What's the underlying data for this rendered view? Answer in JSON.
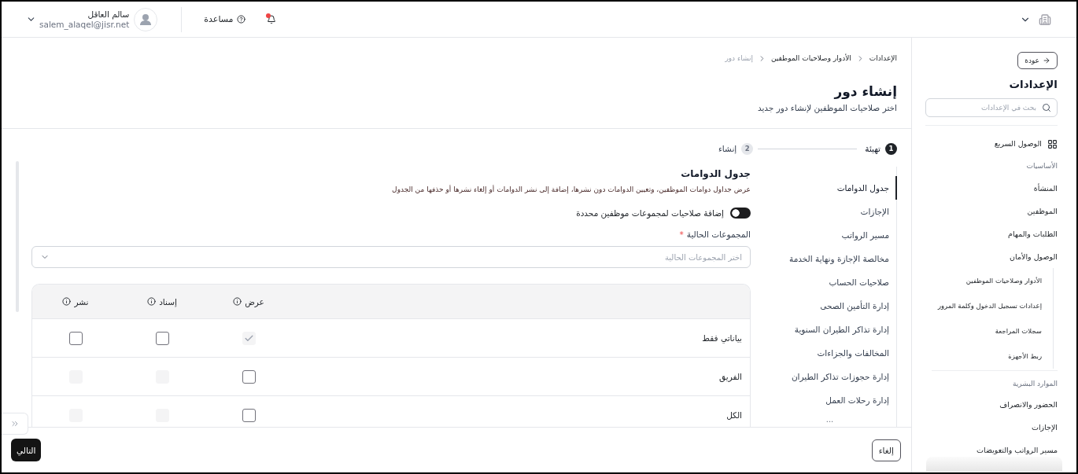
{
  "top_bar": {
    "notifications": {
      "unread": true
    },
    "help": {
      "label": "مساعدة"
    },
    "user": {
      "name": "سالم العاقل",
      "email": "salem_alaqel@jisr.net"
    }
  },
  "sidebar": {
    "back_button": {
      "label": "عودة"
    },
    "title": "الإعدادات",
    "search": {
      "placeholder": "بحث في الإعدادات"
    },
    "quick_access": {
      "label": "الوصول السريع"
    },
    "sections": [
      {
        "heading": "الأساسيات",
        "items": [
          {
            "label": "المنشأة"
          },
          {
            "label": "الموظفين"
          },
          {
            "label": "الطلبات والمهام"
          },
          {
            "label": "الوصول والأمان",
            "children": [
              {
                "label": "الأدوار وصلاحيات الموظفين"
              },
              {
                "label": "إعدادات تسجيل الدخول وكلمة المرور"
              },
              {
                "label": "سجلات المراجعة"
              },
              {
                "label": "ربط الأجهزة"
              }
            ]
          }
        ]
      },
      {
        "heading": "الموارد البشرية",
        "items": [
          {
            "label": "الحضور والانصراف"
          },
          {
            "label": "الإجازات"
          },
          {
            "label": "مسير الرواتب والتعويضات"
          }
        ]
      }
    ]
  },
  "breadcrumb": [
    {
      "label": "الإعدادات",
      "current": false
    },
    {
      "label": "الأدوار وصلاحيات الموظفين",
      "current": false
    },
    {
      "label": "إنشاء دور",
      "current": true
    }
  ],
  "page": {
    "title": "إنشاء دور",
    "subtitle": "اختر صلاحيات الموظفين لإنشاء دور جديد"
  },
  "stepper": [
    {
      "number": "1",
      "label": "تهيئة",
      "selected": true
    },
    {
      "number": "2",
      "label": "إنشاء",
      "selected": false
    }
  ],
  "section_nav": {
    "items": [
      {
        "label": "جدول الدوامات",
        "selected": true
      },
      {
        "label": "الإجازات",
        "selected": false
      },
      {
        "label": "مسير الرواتب",
        "selected": false
      },
      {
        "label": "مخالصة الإجازة ونهاية الخدمة",
        "selected": false
      },
      {
        "label": "صلاحيات الحساب",
        "selected": false
      },
      {
        "label": "إدارة التأمين الصحى",
        "selected": false
      },
      {
        "label": "إدارة تذاكر الطيران السنوية",
        "selected": false
      },
      {
        "label": "المخالفات والجزاءات",
        "selected": false
      },
      {
        "label": "إدارة حجوزات تذاكر الطيران",
        "selected": false
      },
      {
        "label": "إدارة رحلات العمل",
        "selected": false
      }
    ],
    "more": "..."
  },
  "section": {
    "title": "جدول الدوامات",
    "description": "عرض جداول دوامات الموظفين، وتعيين الدوامات دون نشرها، إضافة إلى نشر الدوامات أو إلغاء نشرها أو حذفها من الجدول",
    "toggle": {
      "label": "إضافة صلاحيات لمجموعات موظفين محددة",
      "on": true
    },
    "groups_field": {
      "label": "المجموعات الحالية",
      "required_mark": "*",
      "placeholder": "اختر المجموعات الحالية"
    },
    "table": {
      "columns": [
        {
          "label": "عرض"
        },
        {
          "label": "إسناد"
        },
        {
          "label": "نشر"
        }
      ],
      "rows": [
        {
          "label": "بياناتي فقط",
          "cells": [
            {
              "checked": true,
              "disabled": true
            },
            {
              "checked": false,
              "disabled": false
            },
            {
              "checked": false,
              "disabled": false
            }
          ]
        },
        {
          "label": "الفريق",
          "cells": [
            {
              "checked": false,
              "disabled": false
            },
            {
              "checked": false,
              "disabled": true
            },
            {
              "checked": false,
              "disabled": true
            }
          ]
        },
        {
          "label": "الكل",
          "cells": [
            {
              "checked": false,
              "disabled": false
            },
            {
              "checked": false,
              "disabled": true
            },
            {
              "checked": false,
              "disabled": true
            }
          ]
        }
      ]
    }
  },
  "footer": {
    "cancel_button": "إلغاء",
    "next_button": "التالي"
  }
}
